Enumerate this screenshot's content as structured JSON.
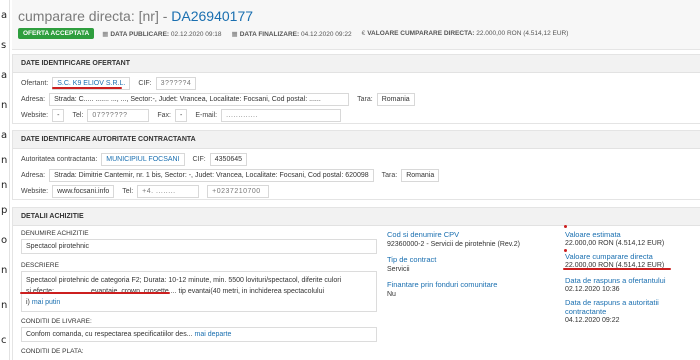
{
  "leftstrip": [
    "a",
    "s",
    "a",
    "n",
    "a",
    "n",
    "n",
    "p",
    "o",
    "n",
    "n",
    "c"
  ],
  "header": {
    "title_prefix": "cumparare directa: [nr] - ",
    "code": "DA26940177",
    "badge": "OFERTA ACCEPTATA",
    "date_publicare_label": "DATA PUBLICARE:",
    "date_publicare": "02.12.2020 09:18",
    "date_finalizare_label": "DATA FINALIZARE:",
    "date_finalizare": "04.12.2020 09:22",
    "valoare_label": "VALOARE CUMPARARE DIRECTA:",
    "valoare": "22.000,00 RON (4.514,12 EUR)"
  },
  "ofertant": {
    "heading": "DATE IDENTIFICARE OFERTANT",
    "ofertant_label": "Ofertant:",
    "ofertant_value": "S.C. K9 ELIOV S.R.L.",
    "cif_label": "CIF:",
    "cif_value": "3?????4",
    "adresa_label": "Adresa:",
    "adresa_value": "Strada: C..... ....... ..., ..., Sector:-, Judet: Vrancea, Localitate: Focsani, Cod postal: ......",
    "tara_label": "Tara:",
    "tara_value": "Romania",
    "website_label": "Website:",
    "website_value": "-",
    "tel_label": "Tel:",
    "tel_value": "07??????",
    "fax_label": "Fax:",
    "fax_value": "-",
    "email_label": "E-mail:",
    "email_value": "............."
  },
  "autoritate": {
    "heading": "DATE IDENTIFICARE AUTORITATE CONTRACTANTA",
    "autoritate_label": "Autoritatea contractanta:",
    "autoritate_value": "MUNICIPIUL FOCSANI",
    "cif_label": "CIF:",
    "cif_value": "4350645",
    "adresa_label": "Adresa:",
    "adresa_value": "Strada: Dimitrie Cantemir, nr. 1 bis, Sector: -, Judet: Vrancea, Localitate: Focsani, Cod postal: 620098",
    "tara_label": "Tara:",
    "tara_value": "Romania",
    "website_label": "Website:",
    "website_value": "www.focsani.info",
    "tel_label": "Tel:",
    "tel_value": "+4. ........",
    "fax_value": "+0237210700"
  },
  "achizitie": {
    "heading": "DETALII ACHIZITIE",
    "denumire_label": "DENUMIRE ACHIZITIE",
    "denumire_value": "Spectacol pirotehnic",
    "descriere_label": "DESCRIERE",
    "descriere_line1": "Spectacol pirotehnic de categoria F2; Durata: 10-12 minute, min. 5500 lovituri/spectacol, diferite culori",
    "descriere_line2": "si efecte: ...... , ...... , evantaie, crown, crosette ... tip evantai(40 metri, in inchiderea spectacolului",
    "descriere_line3": "i)",
    "descriere_more": "mai putin",
    "conditii_livrare_label": "CONDITII DE LIVRARE:",
    "conditii_livrare_value": "Confom comanda, cu respectarea specificatiilor des...",
    "conditii_livrare_more": "mai departe",
    "conditii_plata_label": "CONDITII DE PLATA:",
    "cpv_label": "Cod si denumire CPV",
    "cpv_value": "92360000-2 - Servicii de pirotehnie (Rev.2)",
    "tip_label": "Tip de contract",
    "tip_value": "Servicii",
    "fonduri_label": "Finantare prin fonduri comunitare",
    "fonduri_value": "Nu",
    "valoare_estimata_label": "Valoare estimata",
    "valoare_estimata_value": "22.000,00 RON (4.514,12  EUR)",
    "valoare_cumparare_label": "Valoare cumparare directa",
    "valoare_cumparare_value": "22.000,00  RON (4.514,12  EUR)",
    "data_raspuns_ofertant_label": "Data de raspuns a ofertantului",
    "data_raspuns_ofertant_value": "02.12.2020 10:36",
    "data_raspuns_autoritate_label": "Data de raspuns a autoritatii contractante",
    "data_raspuns_autoritate_value": "04.12.2020 09:22"
  },
  "colors": {
    "accent_blue": "#1a6fb0",
    "badge_green": "#2e9e3e",
    "annotation_red": "#cc1f1f"
  }
}
